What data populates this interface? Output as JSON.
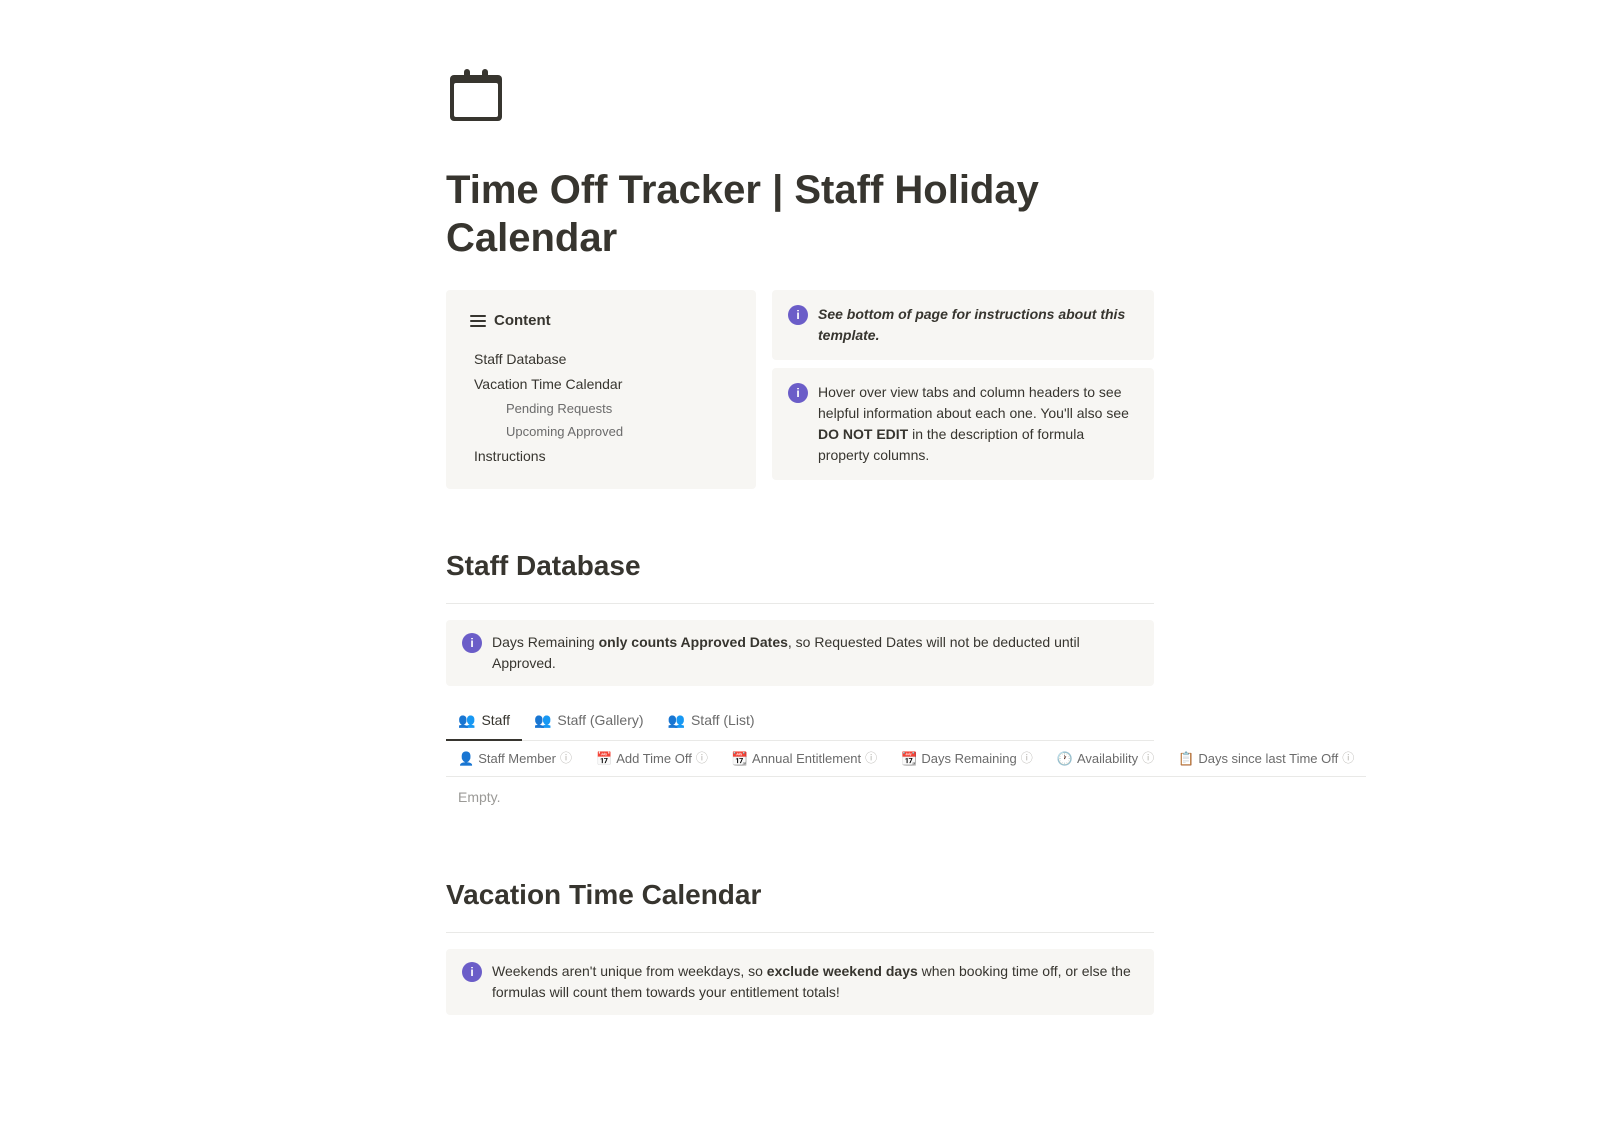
{
  "page": {
    "icon": "📅",
    "title": "Time Off Tracker | Staff Holiday Calendar"
  },
  "toc": {
    "header": "Content",
    "items": [
      {
        "label": "Staff Database",
        "level": 1
      },
      {
        "label": "Vacation Time Calendar",
        "level": 1
      },
      {
        "label": "Pending Requests",
        "level": 3
      },
      {
        "label": "Upcoming Approved",
        "level": 3
      },
      {
        "label": "Instructions",
        "level": 1
      }
    ]
  },
  "info_blocks": [
    {
      "id": "info1",
      "text_italic": "See bottom of page for instructions about this template."
    },
    {
      "id": "info2",
      "text_before": "Hover over view tabs and column headers to see helpful information about each one. You'll also see ",
      "text_bold": "DO NOT EDIT",
      "text_after": " in the description of formula property columns."
    }
  ],
  "staff_database": {
    "title": "Staff Database",
    "notice": {
      "text_before": "Days Remaining ",
      "text_bold": "only counts Approved Dates",
      "text_after": ", so Requested Dates will not be deducted until Approved."
    },
    "tabs": [
      {
        "label": "Staff",
        "active": true
      },
      {
        "label": "Staff (Gallery)",
        "active": false
      },
      {
        "label": "Staff (List)",
        "active": false
      }
    ],
    "columns": [
      {
        "label": "Staff Member",
        "has_info": true
      },
      {
        "label": "Add Time Off",
        "has_info": true
      },
      {
        "label": "Annual Entitlement",
        "has_info": true
      },
      {
        "label": "Days Remaining",
        "has_info": true
      },
      {
        "label": "Availability",
        "has_info": true
      },
      {
        "label": "Days since last Time Off",
        "has_info": true
      }
    ],
    "empty_text": "Empty."
  },
  "vacation_calendar": {
    "title": "Vacation Time Calendar",
    "notice": {
      "text_before": "Weekends aren't unique from weekdays, so ",
      "text_bold": "exclude weekend days",
      "text_after": " when booking time off, or else the formulas will count them towards your entitlement totals!"
    }
  },
  "icons": {
    "info": "ℹ",
    "people": "👥",
    "calendar_small": "📅",
    "clock": "🕐",
    "calendar_col": "📆",
    "person": "👤"
  }
}
